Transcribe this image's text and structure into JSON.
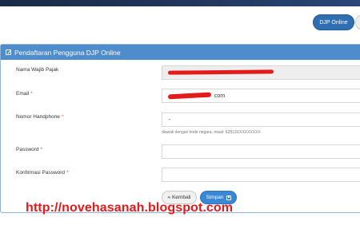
{
  "header": {
    "nav_button_label": "DJP Online"
  },
  "panel": {
    "title": "Pendaftaran Pengguna DJP Online"
  },
  "form": {
    "nama_label": "Nama Wajib Pajak",
    "email_label": "Email",
    "email_value_visible": "com",
    "hp_label": "Nomor Handphone",
    "hp_value": "-",
    "hp_hint": "diawali dengan kode negara, misal: 62813XXXXXXXXX",
    "password_label": "Password",
    "confirm_label": "Konfirmasi Password",
    "required_mark": "*"
  },
  "buttons": {
    "back_label": "« Kembali",
    "save_label": "Simpan"
  },
  "watermark": "http://novehasanah.blogspot.com",
  "colors": {
    "header_blue": "#4e8ccb",
    "primary_button": "#3a87d6",
    "redaction_red": "#e41b1b"
  }
}
